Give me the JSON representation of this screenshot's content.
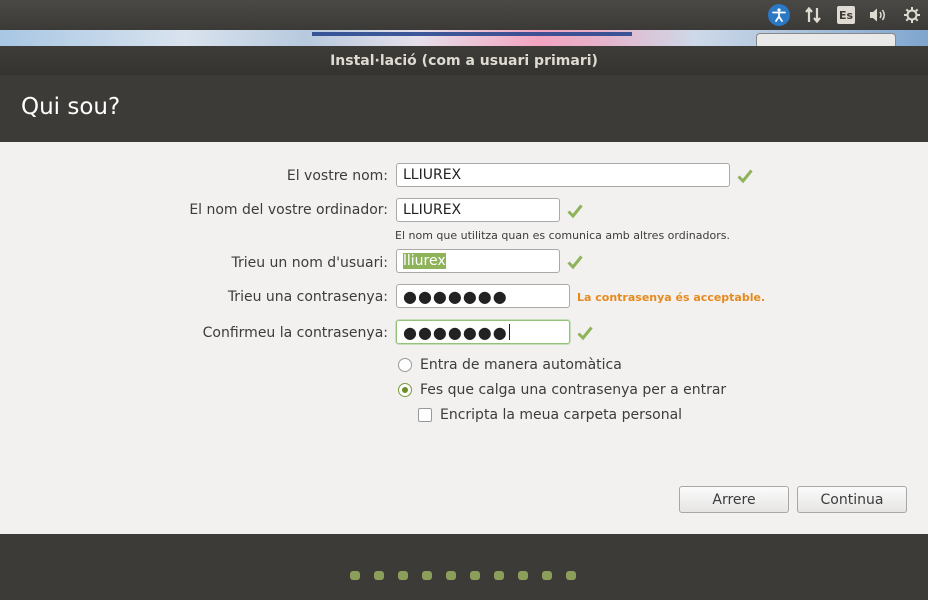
{
  "panel": {
    "icons": [
      "accessibility-icon",
      "network-icon",
      "keyboard-layout-indicator",
      "volume-icon",
      "power-icon"
    ],
    "keyboard_layout": "Es"
  },
  "window": {
    "title": "Instal·lació (com a usuari primari)"
  },
  "header": {
    "title": "Qui sou?"
  },
  "form": {
    "name_label": "El vostre nom:",
    "name_value": "LLIUREX",
    "computer_label": "El nom del vostre ordinador:",
    "computer_value": "LLIUREX",
    "computer_hint": "El nom que utilitza quan es comunica amb altres ordinadors.",
    "username_label": "Trieu un nom d'usuari:",
    "username_value": "lliurex",
    "password_label": "Trieu una contrasenya:",
    "password_value": "●●●●●●●",
    "password_status": "La contrasenya és acceptable.",
    "confirm_label": "Confirmeu la contrasenya:",
    "confirm_value": "●●●●●●●",
    "login_auto": "Entra de manera automàtica",
    "login_password": "Fes que calga una contrasenya per a entrar",
    "encrypt_home": "Encripta la meua carpeta personal",
    "selected_login": "login_password",
    "encrypt_checked": false
  },
  "buttons": {
    "back": "Arrere",
    "continue": "Continua"
  },
  "progress": {
    "total_steps": 10
  },
  "colors": {
    "accent": "#8c9f5a",
    "check": "#8fb35a",
    "warning_text": "#e78a1e"
  }
}
